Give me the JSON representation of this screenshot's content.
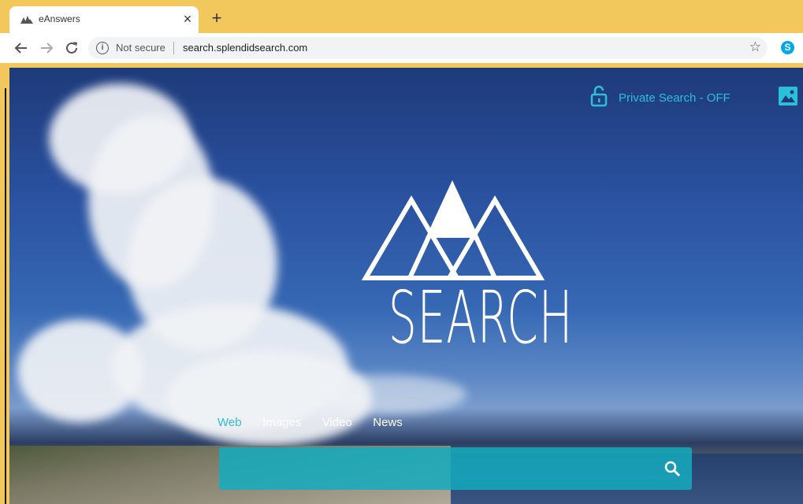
{
  "browser": {
    "tab_title": "eAnswers",
    "close_glyph": "×",
    "new_tab_glyph": "+",
    "security_text": "Not secure",
    "url": "search.splendidsearch.com",
    "star_glyph": "☆",
    "skype_glyph": "S"
  },
  "page": {
    "private_search_label": "Private Search - OFF",
    "logo_text": "SEARCH",
    "search_tabs": [
      "Web",
      "Images",
      "Video",
      "News"
    ],
    "active_tab": "Web",
    "search_placeholder": ""
  },
  "colors": {
    "accent": "#2bbfd8",
    "frame": "#f2c75c",
    "search_bar": "#14acbe"
  },
  "icons": {
    "lock": "lock-icon",
    "background": "image-icon",
    "search": "search-icon"
  }
}
